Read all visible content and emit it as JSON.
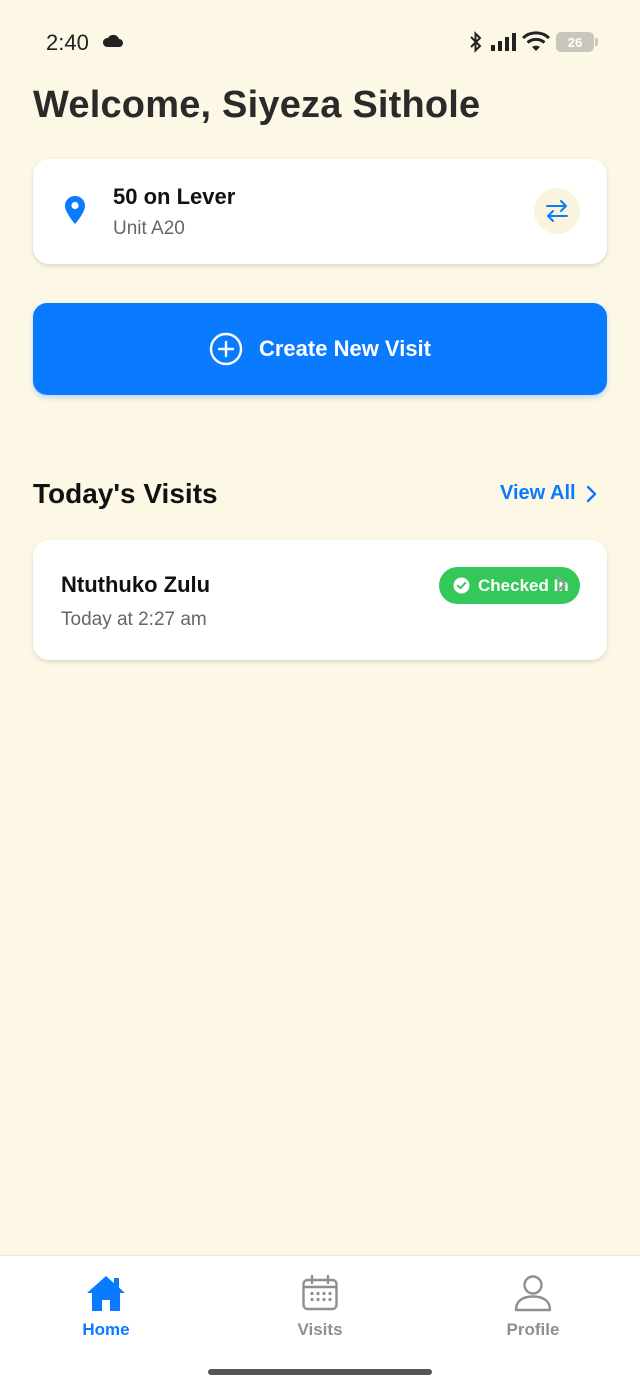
{
  "status_bar": {
    "time": "2:40",
    "battery": "26"
  },
  "welcome": {
    "title": "Welcome, Siyeza Sithole"
  },
  "location": {
    "name": "50 on Lever",
    "unit": "Unit A20"
  },
  "actions": {
    "create_visit_label": "Create New Visit"
  },
  "todays_visits": {
    "title": "Today's Visits",
    "view_all_label": "View All",
    "items": [
      {
        "name": "Ntuthuko Zulu",
        "time": "Today at 2:27 am",
        "status": "Checked In"
      }
    ]
  },
  "bottom_nav": {
    "items": [
      {
        "label": "Home",
        "icon": "home-icon",
        "active": true
      },
      {
        "label": "Visits",
        "icon": "calendar-icon",
        "active": false
      },
      {
        "label": "Profile",
        "icon": "person-icon",
        "active": false
      }
    ]
  },
  "colors": {
    "primary": "#0a7bff",
    "background": "#fdf8e6",
    "success": "#34c759"
  }
}
